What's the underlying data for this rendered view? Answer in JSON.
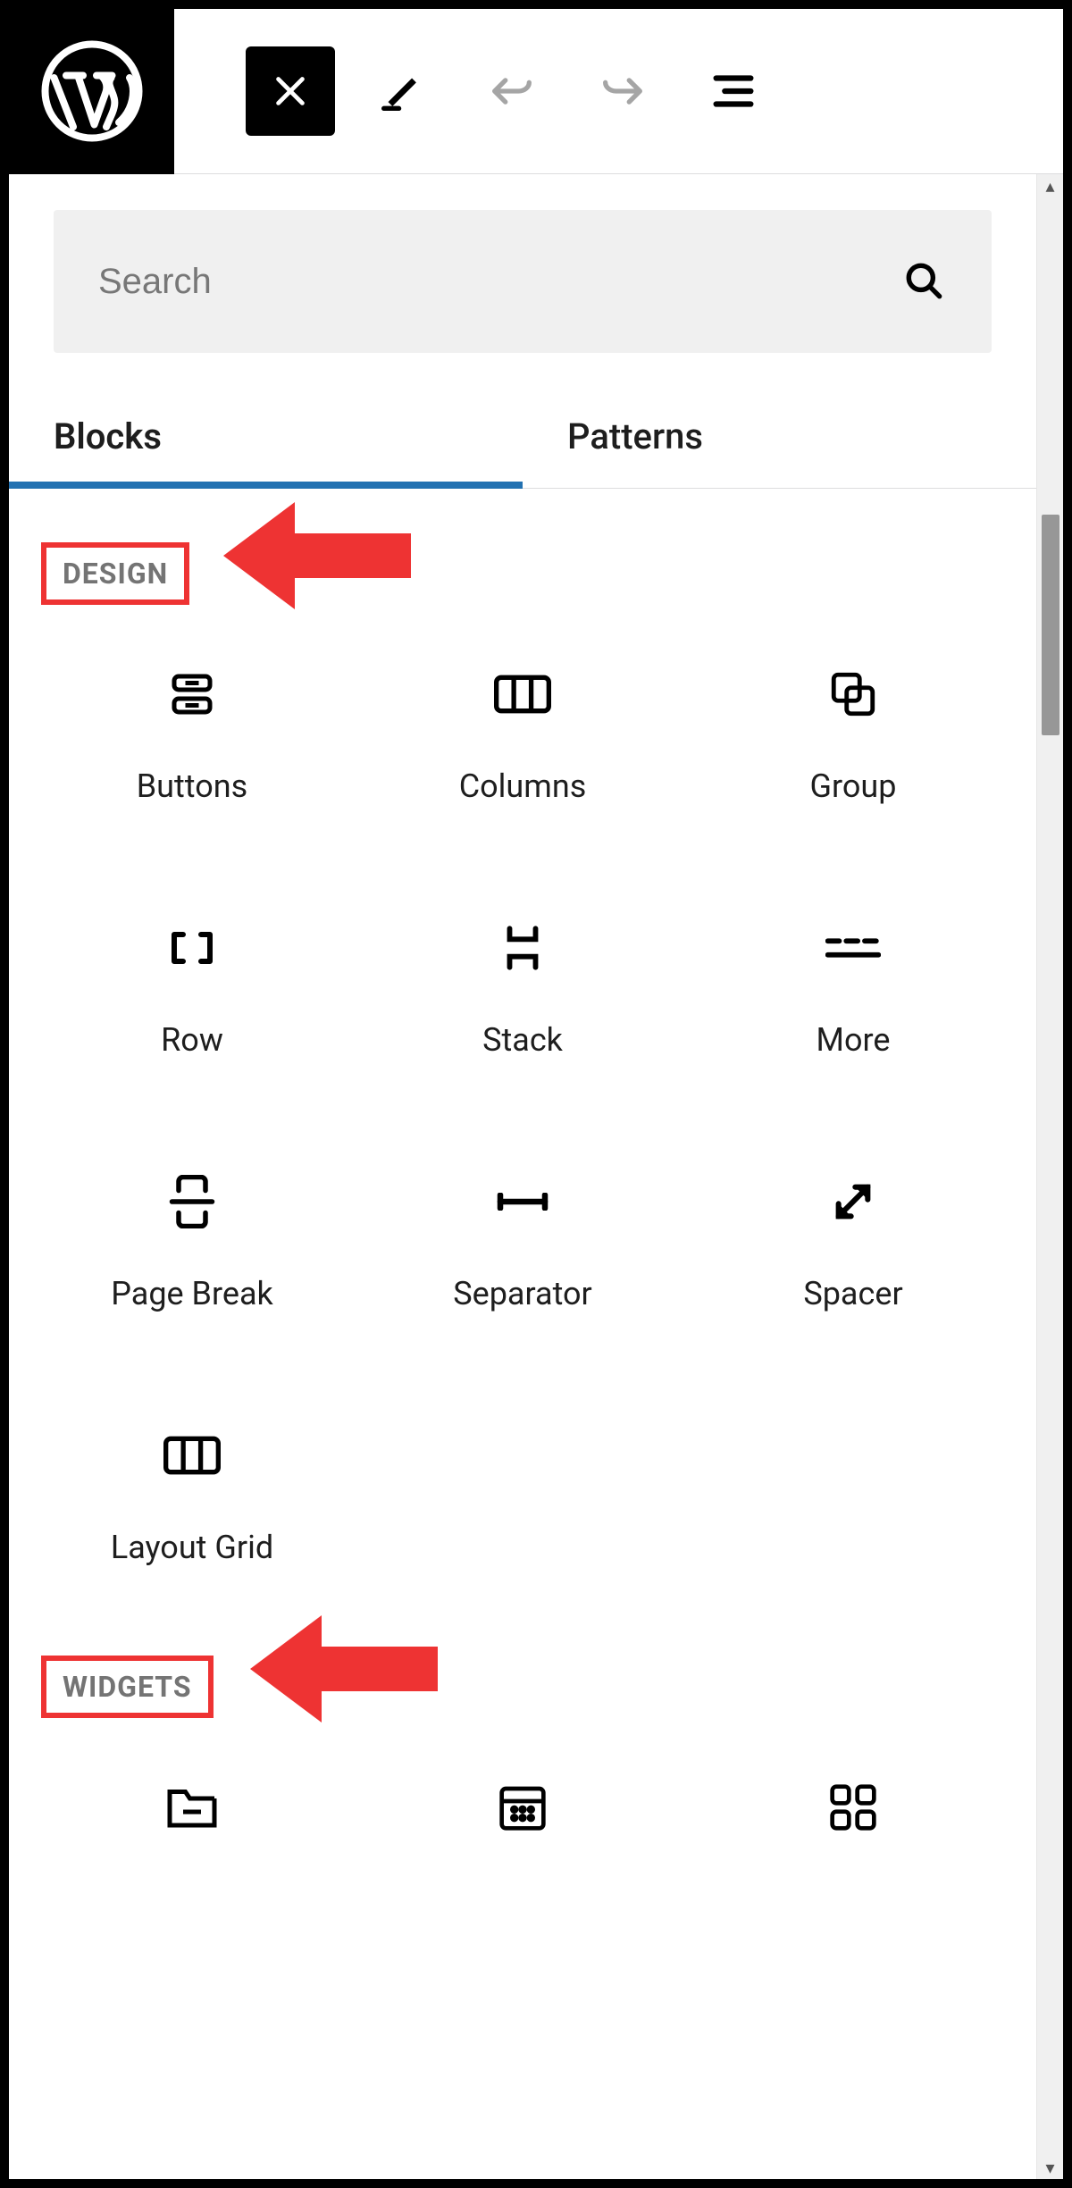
{
  "toolbar": {
    "logo": "wordpress",
    "buttons": {
      "inserter": "close-inserter",
      "tools": "edit-tools",
      "undo": "undo",
      "redo": "redo",
      "listview": "document-outline"
    }
  },
  "inserter": {
    "search": {
      "placeholder": "Search",
      "value": ""
    },
    "tabs": [
      {
        "id": "blocks",
        "label": "Blocks",
        "active": true
      },
      {
        "id": "patterns",
        "label": "Patterns",
        "active": false
      }
    ],
    "scrollbar": {
      "thumb_top_pct": 17,
      "thumb_height_pct": 11
    },
    "categories": [
      {
        "id": "design",
        "title": "DESIGN",
        "highlighted": true,
        "blocks": [
          {
            "id": "buttons",
            "label": "Buttons",
            "icon": "buttons"
          },
          {
            "id": "columns",
            "label": "Columns",
            "icon": "columns"
          },
          {
            "id": "group",
            "label": "Group",
            "icon": "group"
          },
          {
            "id": "row",
            "label": "Row",
            "icon": "row"
          },
          {
            "id": "stack",
            "label": "Stack",
            "icon": "stack"
          },
          {
            "id": "more",
            "label": "More",
            "icon": "more"
          },
          {
            "id": "page-break",
            "label": "Page Break",
            "icon": "page-break"
          },
          {
            "id": "separator",
            "label": "Separator",
            "icon": "separator"
          },
          {
            "id": "spacer",
            "label": "Spacer",
            "icon": "spacer"
          },
          {
            "id": "layout-grid",
            "label": "Layout Grid",
            "icon": "layout-grid"
          }
        ]
      },
      {
        "id": "widgets",
        "title": "WIDGETS",
        "highlighted": true,
        "blocks": [
          {
            "id": "archives",
            "label": "",
            "icon": "archives"
          },
          {
            "id": "calendar",
            "label": "",
            "icon": "calendar"
          },
          {
            "id": "categories",
            "label": "",
            "icon": "categories"
          }
        ]
      }
    ]
  },
  "annotation": {
    "color": "#e33"
  }
}
